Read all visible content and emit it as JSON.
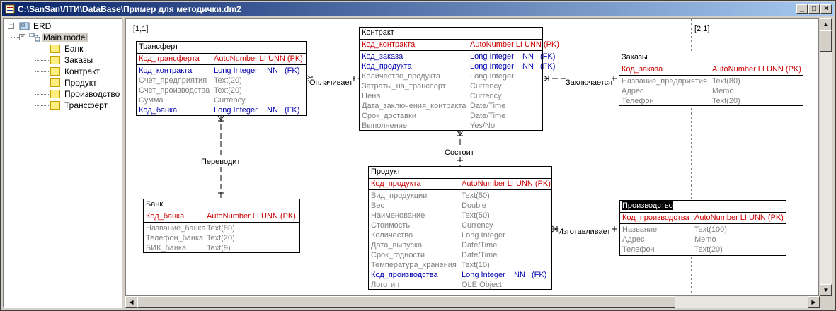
{
  "window": {
    "title": "C:\\SanSan\\ЛТИ\\DataBase\\Пример для методички.dm2"
  },
  "tree": {
    "root": "ERD",
    "model": "Main model",
    "items": [
      "Банк",
      "Заказы",
      "Контракт",
      "Продукт",
      "Производство",
      "Трансферт"
    ]
  },
  "pages": [
    "[1,1]",
    "[2,1]"
  ],
  "entities": {
    "transfer": {
      "name": "Трансферт",
      "rows": [
        {
          "name": "Код_трансферта",
          "type": "AutoNumber LI UNN (PK)",
          "nn": "",
          "key": "",
          "kind": "pk"
        },
        {
          "name": "Код_контракта",
          "type": "Long Integer",
          "nn": "NN",
          "key": "(FK)",
          "kind": "fk"
        },
        {
          "name": "Счет_предприятия",
          "type": "Text(20)",
          "nn": "",
          "key": "",
          "kind": "n"
        },
        {
          "name": "Счет_производства",
          "type": "Text(20)",
          "nn": "",
          "key": "",
          "kind": "n"
        },
        {
          "name": "Сумма",
          "type": "Currency",
          "nn": "",
          "key": "",
          "kind": "n"
        },
        {
          "name": "Код_банка",
          "type": "Long Integer",
          "nn": "NN",
          "key": "(FK)",
          "kind": "fk"
        }
      ]
    },
    "contract": {
      "name": "Контракт",
      "rows": [
        {
          "name": "Код_контракта",
          "type": "AutoNumber LI UNN (PK)",
          "nn": "",
          "key": "",
          "kind": "pk"
        },
        {
          "name": "Код_заказа",
          "type": "Long Integer",
          "nn": "NN",
          "key": "(FK)",
          "kind": "fk"
        },
        {
          "name": "Код_продукта",
          "type": "Long Integer",
          "nn": "NN",
          "key": "(FK)",
          "kind": "fk"
        },
        {
          "name": "Количество_продукта",
          "type": "Long Integer",
          "nn": "",
          "key": "",
          "kind": "n"
        },
        {
          "name": "Затраты_на_транспорт",
          "type": "Currency",
          "nn": "",
          "key": "",
          "kind": "n"
        },
        {
          "name": "Цена",
          "type": "Currency",
          "nn": "",
          "key": "",
          "kind": "n"
        },
        {
          "name": "Дата_заключения_контракта",
          "type": "Date/Time",
          "nn": "",
          "key": "",
          "kind": "n"
        },
        {
          "name": "Срок_доставки",
          "type": "Date/Time",
          "nn": "",
          "key": "",
          "kind": "n"
        },
        {
          "name": "Выполнение",
          "type": "Yes/No",
          "nn": "",
          "key": "",
          "kind": "n"
        }
      ]
    },
    "orders": {
      "name": "Заказы",
      "rows": [
        {
          "name": "Код_заказа",
          "type": "AutoNumber LI UNN (PK)",
          "nn": "",
          "key": "",
          "kind": "pk"
        },
        {
          "name": "Название_предприятия",
          "type": "Text(80)",
          "nn": "",
          "key": "",
          "kind": "n"
        },
        {
          "name": "Адрес",
          "type": "Memo",
          "nn": "",
          "key": "",
          "kind": "n"
        },
        {
          "name": "Телефон",
          "type": "Text(20)",
          "nn": "",
          "key": "",
          "kind": "n"
        }
      ]
    },
    "bank": {
      "name": "Банк",
      "rows": [
        {
          "name": "Код_банка",
          "type": "AutoNumber LI UNN (PK)",
          "nn": "",
          "key": "",
          "kind": "pk"
        },
        {
          "name": "Название_банка",
          "type": "Text(80)",
          "nn": "",
          "key": "",
          "kind": "n"
        },
        {
          "name": "Телефон_банка",
          "type": "Text(20)",
          "nn": "",
          "key": "",
          "kind": "n"
        },
        {
          "name": "БИК_банка",
          "type": "Text(9)",
          "nn": "",
          "key": "",
          "kind": "n"
        }
      ]
    },
    "product": {
      "name": "Продукт",
      "rows": [
        {
          "name": "Код_продукта",
          "type": "AutoNumber LI UNN (PK)",
          "nn": "",
          "key": "",
          "kind": "pk"
        },
        {
          "name": "Вид_продукции",
          "type": "Text(50)",
          "nn": "",
          "key": "",
          "kind": "n"
        },
        {
          "name": "Вес",
          "type": "Double",
          "nn": "",
          "key": "",
          "kind": "n"
        },
        {
          "name": "Наименование",
          "type": "Text(50)",
          "nn": "",
          "key": "",
          "kind": "n"
        },
        {
          "name": "Стоимость",
          "type": "Currency",
          "nn": "",
          "key": "",
          "kind": "n"
        },
        {
          "name": "Количество",
          "type": "Long Integer",
          "nn": "",
          "key": "",
          "kind": "n"
        },
        {
          "name": "Дата_выпуска",
          "type": "Date/Time",
          "nn": "",
          "key": "",
          "kind": "n"
        },
        {
          "name": "Срок_годности",
          "type": "Date/Time",
          "nn": "",
          "key": "",
          "kind": "n"
        },
        {
          "name": "Температура_хранения",
          "type": "Text(10)",
          "nn": "",
          "key": "",
          "kind": "n"
        },
        {
          "name": "Код_производства",
          "type": "Long Integer",
          "nn": "NN",
          "key": "(FK)",
          "kind": "fk"
        },
        {
          "name": "Логотип",
          "type": "OLE Object",
          "nn": "",
          "key": "",
          "kind": "n"
        }
      ]
    },
    "production": {
      "name": "Производство",
      "rows": [
        {
          "name": "Код_производства",
          "type": "AutoNumber LI UNN (PK)",
          "nn": "",
          "key": "",
          "kind": "pk"
        },
        {
          "name": "Название",
          "type": "Text(100)",
          "nn": "",
          "key": "",
          "kind": "n"
        },
        {
          "name": "Адрес",
          "type": "Memo",
          "nn": "",
          "key": "",
          "kind": "n"
        },
        {
          "name": "Телефон",
          "type": "Text(20)",
          "nn": "",
          "key": "",
          "kind": "n"
        }
      ]
    }
  },
  "relations": {
    "pays": "Оплачивает",
    "concludes": "Заключается",
    "consists": "Состоит",
    "transfers": "Переводит",
    "manufactures": "Изготавливает"
  }
}
